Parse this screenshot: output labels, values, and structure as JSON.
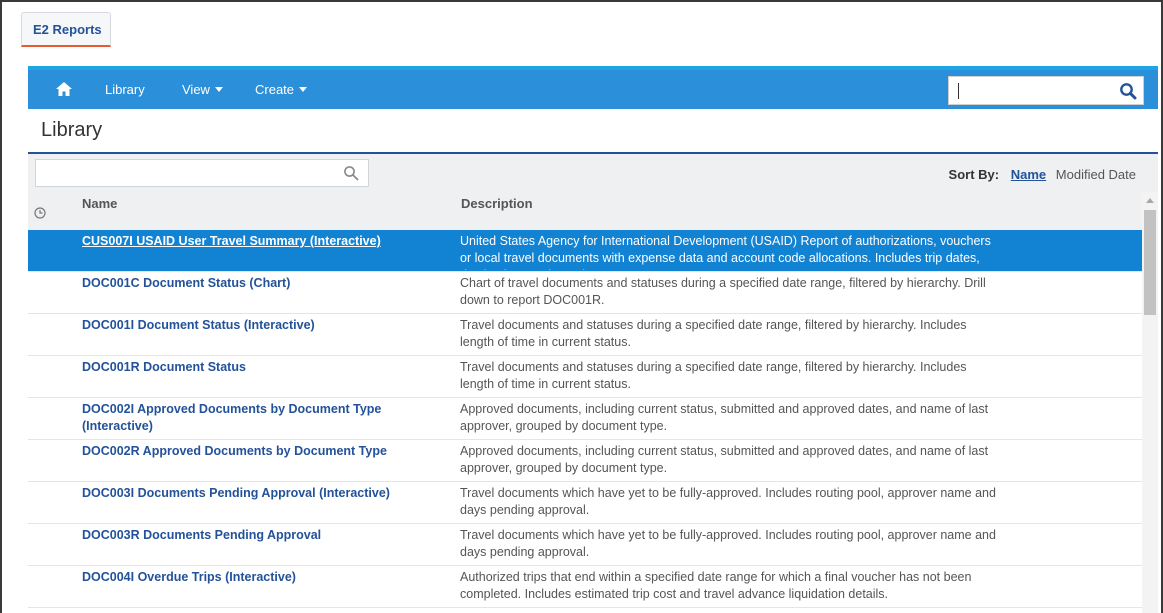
{
  "app": {
    "tab_label": "E2 Reports"
  },
  "nav": {
    "home_icon": "home-icon",
    "library_label": "Library",
    "view_label": "View",
    "create_label": "Create",
    "search_value": "",
    "search_icon": "search-icon"
  },
  "page": {
    "title": "Library"
  },
  "filter": {
    "placeholder": "",
    "value": ""
  },
  "sort": {
    "label": "Sort By:",
    "options": [
      "Name",
      "Modified Date"
    ],
    "active": "Name"
  },
  "table": {
    "columns": [
      "Name",
      "Description"
    ],
    "rows": [
      {
        "name": "CUS007I USAID User Travel Summary (Interactive)",
        "description": "United States Agency for International Development (USAID) Report of authorizations, vouchers or local travel documents with expense data and account code allocations. Includes trip dates, destinations and travelers",
        "selected": true
      },
      {
        "name": "DOC001C Document Status (Chart)",
        "description": "Chart of travel documents and statuses during a specified date range, filtered by hierarchy. Drill down to report DOC001R.",
        "selected": false
      },
      {
        "name": "DOC001I Document Status (Interactive)",
        "description": "Travel documents and statuses during a specified date range, filtered by hierarchy. Includes length of time in current status.",
        "selected": false
      },
      {
        "name": "DOC001R Document Status",
        "description": "Travel documents and statuses during a specified date range, filtered by hierarchy. Includes length of time in current status.",
        "selected": false
      },
      {
        "name": "DOC002I Approved Documents by Document Type (Interactive)",
        "description": "Approved documents, including current status, submitted and approved dates, and name of last approver, grouped by document type.",
        "selected": false
      },
      {
        "name": "DOC002R Approved Documents by Document Type",
        "description": "Approved documents, including current status, submitted and approved dates, and name of last approver, grouped by document type.",
        "selected": false
      },
      {
        "name": "DOC003I Documents Pending Approval (Interactive)",
        "description": "Travel documents which have yet to be fully-approved. Includes routing pool, approver name and days pending approval.",
        "selected": false
      },
      {
        "name": "DOC003R Documents Pending Approval",
        "description": "Travel documents which have yet to be fully-approved. Includes routing pool, approver name and days pending approval.",
        "selected": false
      },
      {
        "name": "DOC004I Overdue Trips (Interactive)",
        "description": "Authorized trips that end within a specified date range for which a final voucher has not been completed. Includes estimated trip cost and travel advance liquidation details.",
        "selected": false
      }
    ]
  },
  "colors": {
    "nav_blue": "#2b8fd9",
    "selected_row": "#1282d3",
    "link_blue": "#23529a",
    "tab_accent": "#e85a2f"
  }
}
